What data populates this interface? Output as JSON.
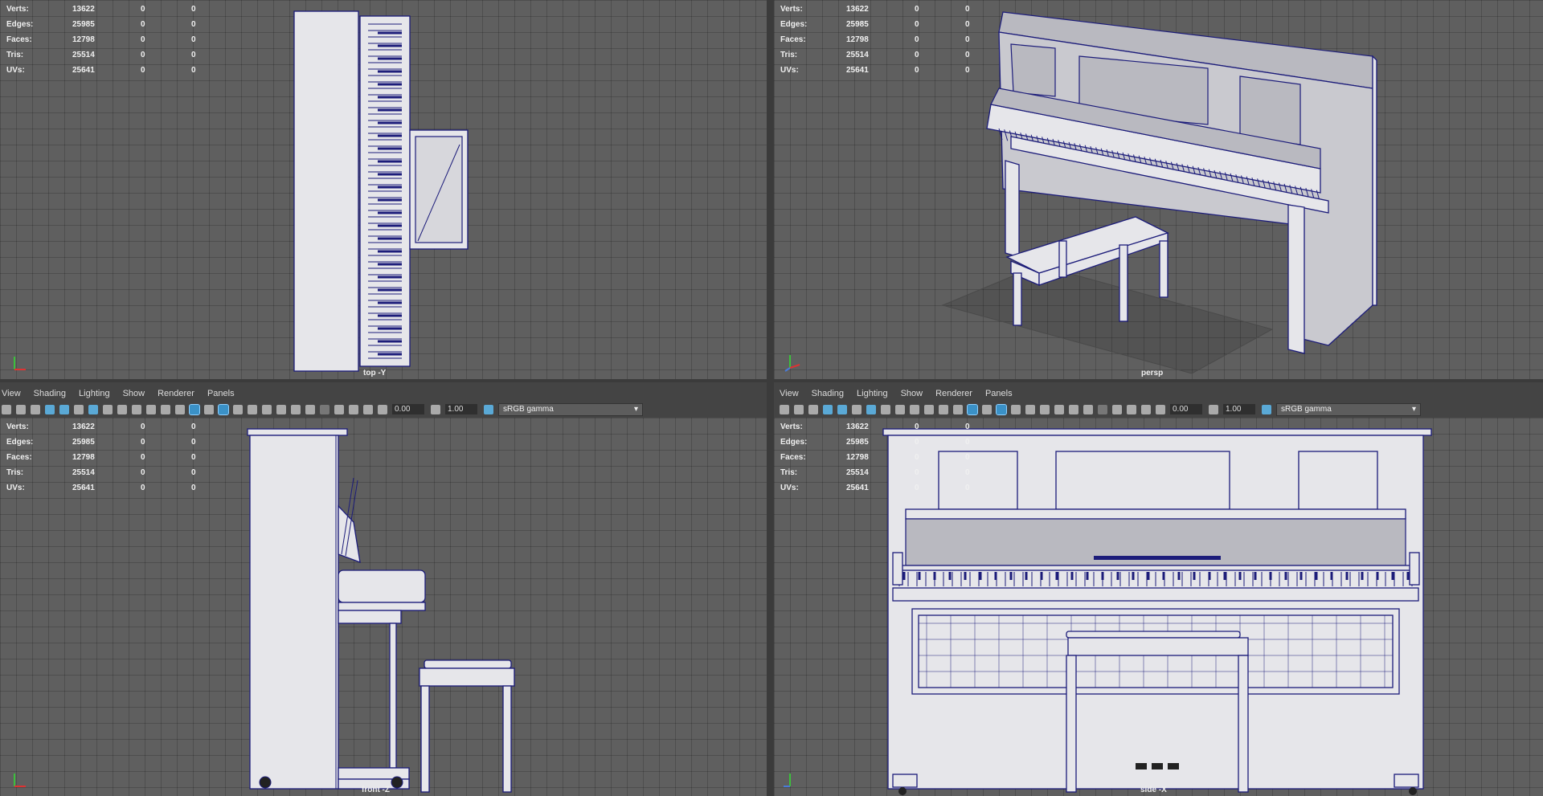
{
  "stats": {
    "rows": [
      {
        "label": "Verts:",
        "v1": "13622",
        "v2": "0",
        "v3": "0"
      },
      {
        "label": "Edges:",
        "v1": "25985",
        "v2": "0",
        "v3": "0"
      },
      {
        "label": "Faces:",
        "v1": "12798",
        "v2": "0",
        "v3": "0"
      },
      {
        "label": "Tris:",
        "v1": "25514",
        "v2": "0",
        "v3": "0"
      },
      {
        "label": "UVs:",
        "v1": "25641",
        "v2": "0",
        "v3": "0"
      }
    ]
  },
  "viewports": {
    "top": {
      "label": "top -Y"
    },
    "persp": {
      "label": "persp"
    },
    "front": {
      "label": "front -Z"
    },
    "side": {
      "label": "side -X"
    }
  },
  "panel_menu": [
    "View",
    "Shading",
    "Lighting",
    "Show",
    "Renderer",
    "Panels"
  ],
  "toolbar": {
    "exposure": "0.00",
    "gamma": "1.00",
    "color_space": "sRGB gamma"
  },
  "colors": {
    "wire": "#1c1c7a",
    "grid": "#5f5f5f",
    "highlight": "#3a91c7"
  }
}
